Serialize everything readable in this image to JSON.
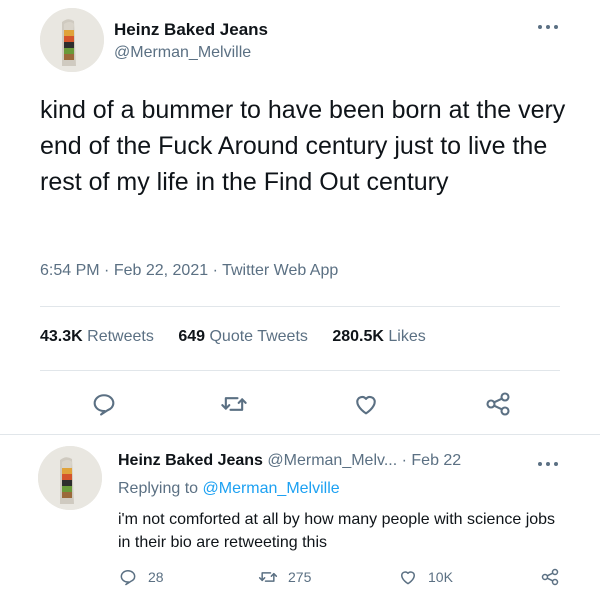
{
  "main_tweet": {
    "display_name": "Heinz Baked Jeans",
    "handle": "@Merman_Melville",
    "text": "kind of a bummer to have been born at the very end of the Fuck Around century just to live the rest of my life in the Find Out century",
    "time": "6:54 PM",
    "date": "Feb 22, 2021",
    "source": "Twitter Web App",
    "stats": {
      "retweets_count": "43.3K",
      "retweets_label": "Retweets",
      "quotes_count": "649",
      "quotes_label": "Quote Tweets",
      "likes_count": "280.5K",
      "likes_label": "Likes"
    }
  },
  "reply_tweet": {
    "display_name": "Heinz Baked Jeans",
    "handle": "@Merman_Melv...",
    "date": "Feb 22",
    "replying_prefix": "Replying to",
    "replying_to": "@Merman_Melville",
    "text": "i'm not comforted at all by how many people with science jobs in their bio are retweeting this",
    "reply_count": "28",
    "retweet_count": "275",
    "like_count": "10K"
  },
  "separators": {
    "dot": "·"
  },
  "icons": {
    "more": "more-horizontal-icon",
    "reply": "reply-icon",
    "retweet": "retweet-icon",
    "like": "heart-icon",
    "share": "share-icon"
  },
  "colors": {
    "text": "#0f1419",
    "secondary": "#5b7083",
    "link": "#1da1f2",
    "divider": "#e1e6ea"
  }
}
